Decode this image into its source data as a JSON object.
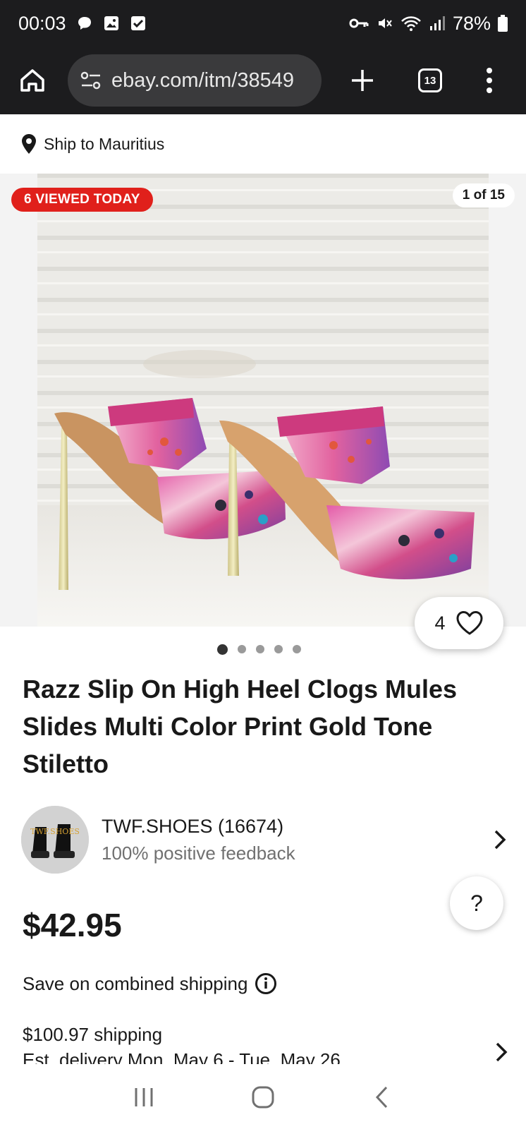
{
  "status_bar": {
    "time": "00:03",
    "battery": "78%",
    "left_icons": [
      "chat-icon",
      "image-icon",
      "checkbox-icon"
    ],
    "right_icons": [
      "key-icon",
      "mute-icon",
      "wifi-icon",
      "signal-icon",
      "battery-icon"
    ]
  },
  "browser": {
    "url": "ebay.com/itm/38549",
    "tab_count": "13"
  },
  "ship_to": "Ship to Mauritius",
  "gallery": {
    "viewed_badge": "6 VIEWED TODAY",
    "image_counter": "1 of 15",
    "watch_count": "4",
    "dot_count": 5,
    "active_dot": 1
  },
  "product": {
    "title": "Razz Slip On High Heel Clogs Mules Slides Multi Color Print Gold Tone Stiletto",
    "price": "$42.95"
  },
  "seller": {
    "name": "TWF.SHOES (16674)",
    "feedback": "100% positive feedback",
    "avatar_text": "TWF.SHOES"
  },
  "help_label": "?",
  "combined_shipping": "Save on combined shipping",
  "shipping": {
    "cost": "$100.97 shipping",
    "delivery_partial": "Est. delivery Mon, May 6 - Tue, May 26"
  },
  "colors": {
    "badge_red": "#e0201b",
    "dark_bar": "#1c1c1e",
    "text": "#191919",
    "muted": "#707070"
  }
}
